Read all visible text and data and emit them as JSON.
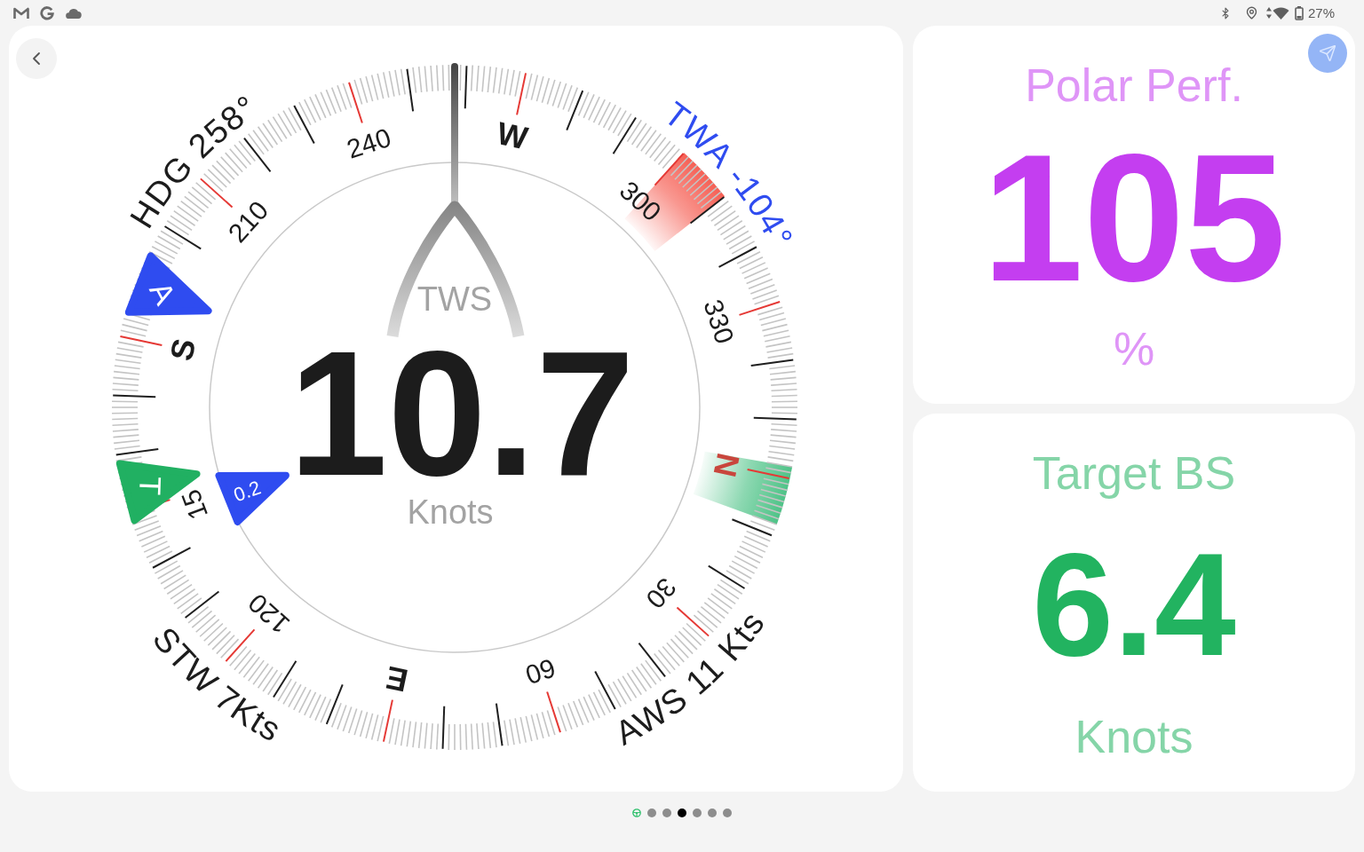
{
  "status_bar": {
    "battery": "27%"
  },
  "compass": {
    "heading": {
      "label": "HDG",
      "value": "258°"
    },
    "true_wind_angle": {
      "label": "TWA",
      "value": "-104°"
    },
    "speed_through_water": {
      "label": "STW",
      "value": "7Kts"
    },
    "apparent_wind_speed": {
      "label": "AWS",
      "value": "11 Kts"
    },
    "scale_labels": [
      {
        "text": "N",
        "kind": "north"
      },
      {
        "text": "30",
        "kind": "number"
      },
      {
        "text": "60",
        "kind": "number"
      },
      {
        "text": "E",
        "kind": "cardinal"
      },
      {
        "text": "120",
        "kind": "number"
      },
      {
        "text": "15",
        "kind": "clipped"
      },
      {
        "text": "S",
        "kind": "cardinal"
      },
      {
        "text": "210",
        "kind": "number"
      },
      {
        "text": "240",
        "kind": "number"
      },
      {
        "text": "W",
        "kind": "cardinal"
      },
      {
        "text": "300",
        "kind": "number"
      },
      {
        "text": "330",
        "kind": "number"
      }
    ],
    "markers": [
      {
        "kind": "apparent",
        "label": "A"
      },
      {
        "kind": "true",
        "label": "T"
      },
      {
        "kind": "leeway",
        "label": "0.2"
      }
    ],
    "readout": {
      "label": "TWS",
      "value": "10.7",
      "unit": "Knots"
    }
  },
  "panels": [
    {
      "title": "Polar Perf.",
      "value": "105",
      "unit": "%",
      "color": "#c43ef0"
    },
    {
      "title": "Target BS",
      "value": "6.4",
      "unit": "Knots",
      "color": "#22b360"
    }
  ],
  "pages": [
    {
      "kind": "wheel",
      "selected": false
    },
    {
      "kind": "dot",
      "selected": false
    },
    {
      "kind": "dot",
      "selected": false
    },
    {
      "kind": "dot",
      "selected": true
    },
    {
      "kind": "dot",
      "selected": false
    },
    {
      "kind": "dot",
      "selected": false
    },
    {
      "kind": "dot",
      "selected": false
    }
  ]
}
